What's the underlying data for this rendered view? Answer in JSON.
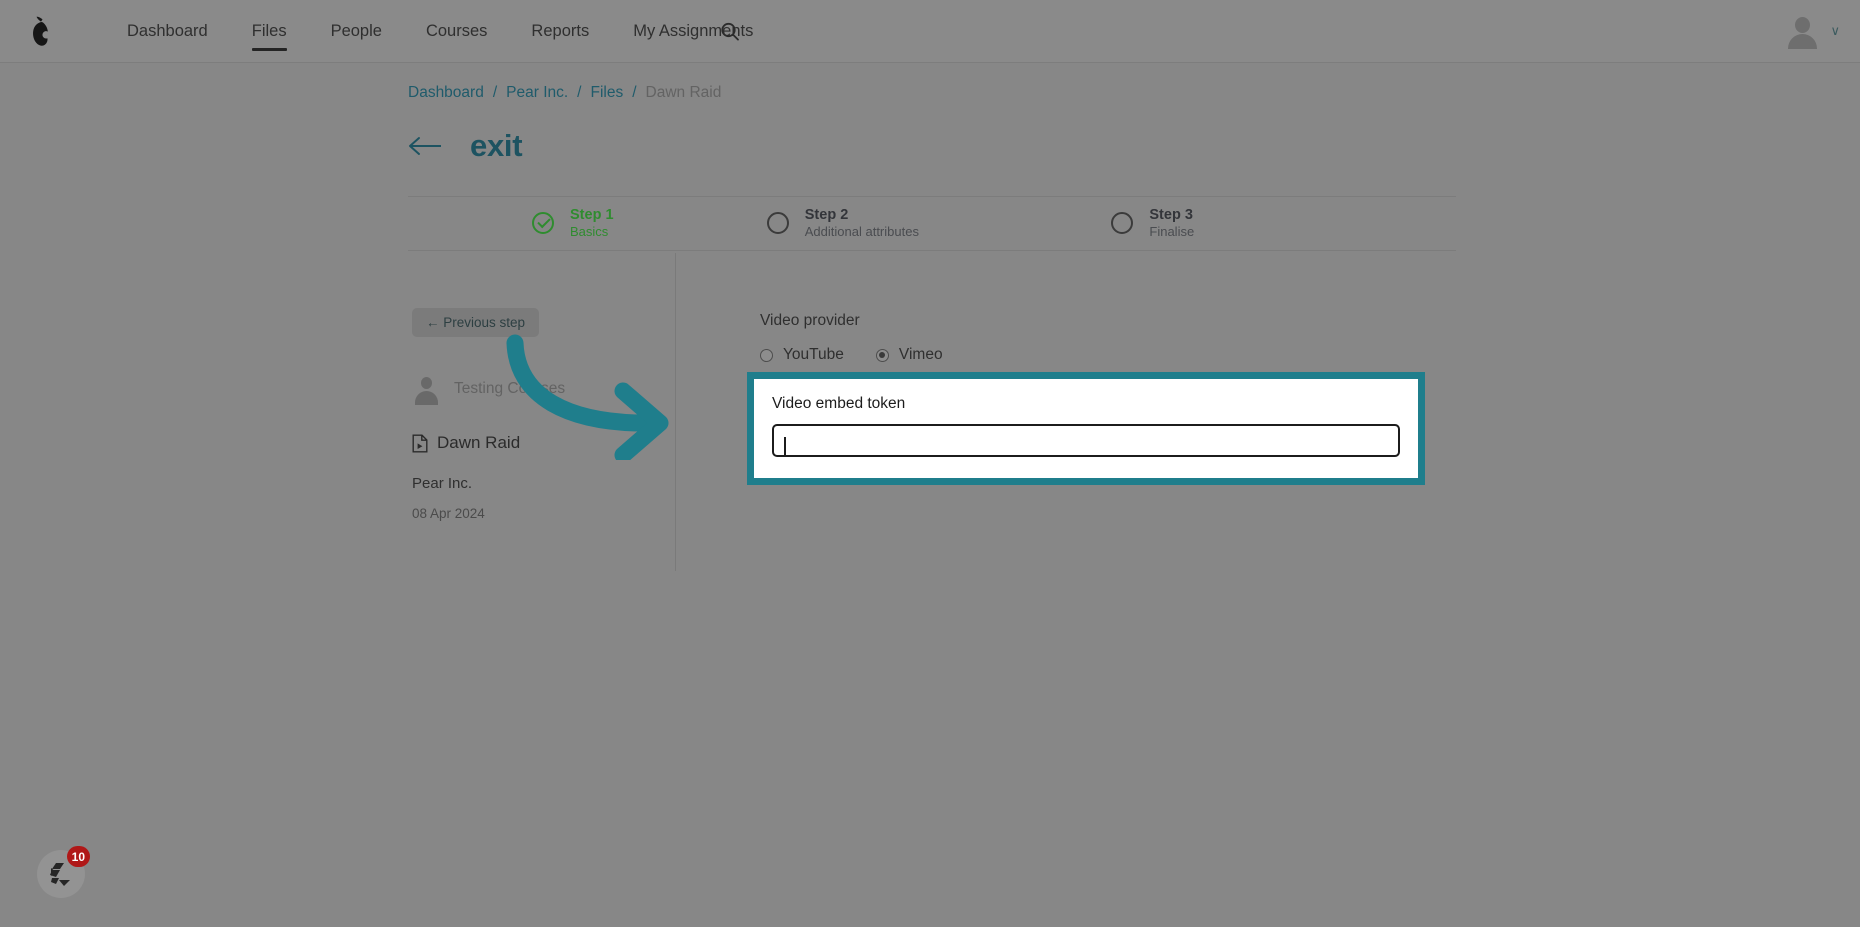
{
  "app": {
    "logo_icon": "pear-logo-icon",
    "accent_teal": "#1f7e8c",
    "link_color": "#1f5b6b",
    "success_green": "#2f8c2f",
    "badge_red": "#b01818"
  },
  "topnav": {
    "items": [
      {
        "label": "Dashboard",
        "active": false
      },
      {
        "label": "Files",
        "active": true
      },
      {
        "label": "People",
        "active": false
      },
      {
        "label": "Courses",
        "active": false
      },
      {
        "label": "Reports",
        "active": false
      },
      {
        "label": "My Assignments",
        "active": false
      }
    ],
    "search_icon": "search-icon",
    "avatar_icon": "user-avatar-icon",
    "user_chevron": "∨"
  },
  "breadcrumb": {
    "separator": "/",
    "items": [
      {
        "label": "Dashboard",
        "current": false
      },
      {
        "label": "Pear Inc.",
        "current": false
      },
      {
        "label": "Files",
        "current": false
      },
      {
        "label": "Dawn Raid",
        "current": true
      }
    ]
  },
  "heading": {
    "back_arrow_icon": "arrow-left-icon",
    "title": "exit"
  },
  "stepper": {
    "steps": [
      {
        "title": "Step 1",
        "subtitle": "Basics",
        "state": "done"
      },
      {
        "title": "Step 2",
        "subtitle": "Additional attributes",
        "state": "pending"
      },
      {
        "title": "Step 3",
        "subtitle": "Finalise",
        "state": "pending"
      }
    ]
  },
  "sidebar": {
    "previous_step_label": "← Previous step",
    "owner_avatar_icon": "user-avatar-icon",
    "owner_name": "Testing Courses",
    "file_icon": "video-file-icon",
    "file_name": "Dawn Raid",
    "organisation": "Pear Inc.",
    "date": "08 Apr 2024"
  },
  "form": {
    "video_provider_label": "Video provider",
    "providers": [
      {
        "label": "YouTube",
        "selected": false
      },
      {
        "label": "Vimeo",
        "selected": true
      }
    ],
    "token_label": "Video embed token",
    "token_value": "",
    "token_placeholder": ""
  },
  "annotation": {
    "arrow_icon": "curved-arrow-right-icon",
    "arrow_color": "#1f7e8c",
    "highlight_color": "#1f7e8c"
  },
  "help_widget": {
    "icon": "help-chat-icon",
    "badge_count": "10"
  }
}
